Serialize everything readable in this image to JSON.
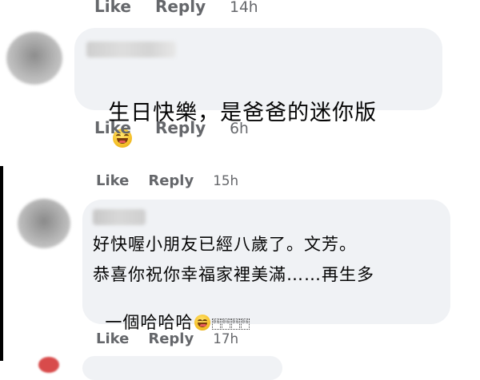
{
  "top_comment": {
    "actions": {
      "like": "Like",
      "reply": "Reply",
      "time": "14h"
    }
  },
  "comment_1": {
    "text": "生日快樂，是爸爸的迷你版",
    "emoji": "grinning-face-emoji",
    "actions": {
      "like": "Like",
      "reply": "Reply",
      "time": "6h"
    }
  },
  "comment_2_prev": {
    "actions": {
      "like": "Like",
      "reply": "Reply",
      "time": "15h"
    }
  },
  "comment_2": {
    "line1": "好快喔小朋友已經八歲了。文芳。",
    "line2": "恭喜你祝你幸福家裡美滿……再生多",
    "line3": "一個哈哈哈",
    "emoji": "grinning-face-emoji",
    "missing_glyph_codes": [
      "06",
      "06",
      "06",
      "06"
    ],
    "actions": {
      "like": "Like",
      "reply": "Reply",
      "time": "17h"
    }
  },
  "colors": {
    "bubble": "#f0f2f5",
    "action_text": "#65676b",
    "body_text": "#050505",
    "divider": "#000000"
  }
}
